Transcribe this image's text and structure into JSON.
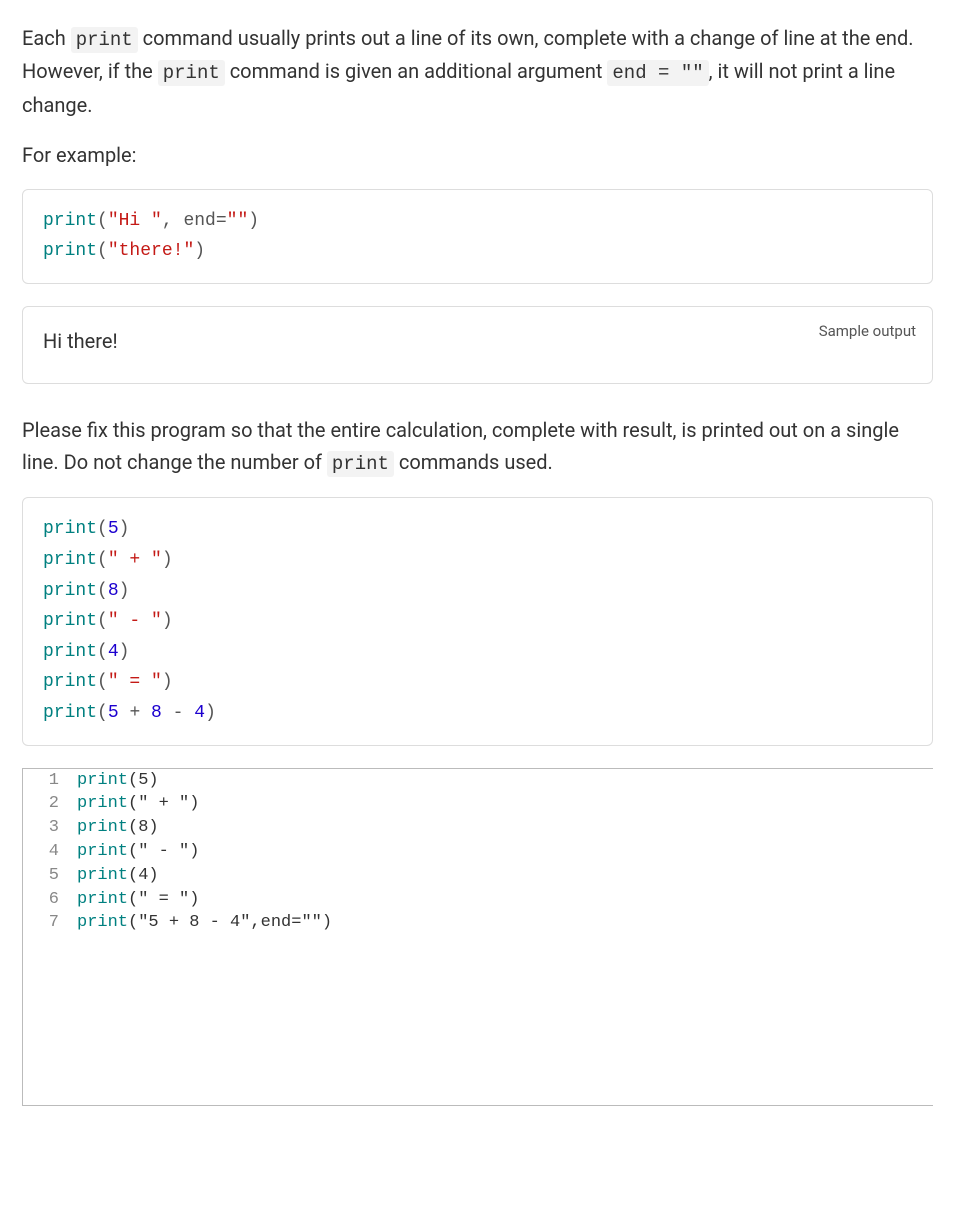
{
  "intro": {
    "part1": "Each ",
    "code1": "print",
    "part2": " command usually prints out a line of its own, complete with a change of line at the end. However, if the ",
    "code2": "print",
    "part3": " command is given an additional argument ",
    "code3": "end = \"\"",
    "part4": ", it will not print a line change."
  },
  "for_example": "For example:",
  "example_code": {
    "l1": {
      "fn": "print",
      "open": "(",
      "str": "\"Hi \"",
      "comma": ", ",
      "arg": "end",
      "eq": "=",
      "val": "\"\"",
      "close": ")"
    },
    "l2": {
      "fn": "print",
      "open": "(",
      "str": "\"there!\"",
      "close": ")"
    }
  },
  "sample_output_label": "Sample output",
  "sample_output_text": "Hi there!",
  "task": {
    "part1": "Please fix this program so that the entire calculation, complete with result, is printed out on a single line. Do not change the number of ",
    "code1": "print",
    "part2": " commands used."
  },
  "task_code": {
    "l1": {
      "fn": "print",
      "open": "(",
      "num": "5",
      "close": ")"
    },
    "l2": {
      "fn": "print",
      "open": "(",
      "str": "\" + \"",
      "close": ")"
    },
    "l3": {
      "fn": "print",
      "open": "(",
      "num": "8",
      "close": ")"
    },
    "l4": {
      "fn": "print",
      "open": "(",
      "str": "\" - \"",
      "close": ")"
    },
    "l5": {
      "fn": "print",
      "open": "(",
      "num": "4",
      "close": ")"
    },
    "l6": {
      "fn": "print",
      "open": "(",
      "str": "\" = \"",
      "close": ")"
    },
    "l7": {
      "fn": "print",
      "open": "(",
      "a": "5",
      "op1": " + ",
      "b": "8",
      "op2": " - ",
      "c": "4",
      "close": ")"
    }
  },
  "editor": {
    "lines": [
      {
        "n": "1",
        "fn": "print",
        "rest": "(5)"
      },
      {
        "n": "2",
        "fn": "print",
        "rest": "(\" + \")"
      },
      {
        "n": "3",
        "fn": "print",
        "rest": "(8)"
      },
      {
        "n": "4",
        "fn": "print",
        "rest": "(\" - \")"
      },
      {
        "n": "5",
        "fn": "print",
        "rest": "(4)"
      },
      {
        "n": "6",
        "fn": "print",
        "rest": "(\" = \")"
      },
      {
        "n": "7",
        "fn": "print",
        "rest": "(\"5 + 8 - 4\",end=\"\")"
      }
    ]
  }
}
